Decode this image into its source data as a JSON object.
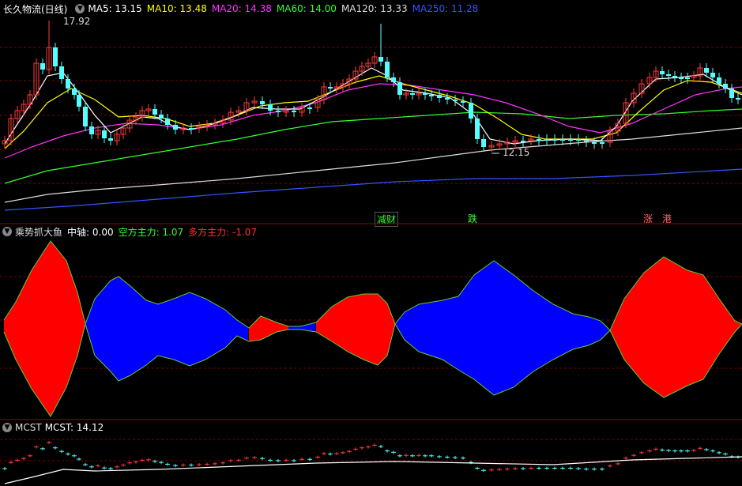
{
  "colors": {
    "up": "#ff3b3b",
    "down": "#54ffff",
    "ma5": "#ffffff",
    "ma10": "#ffff00",
    "ma20": "#ff33ff",
    "ma60": "#33ff33",
    "ma120": "#dddddd",
    "ma250": "#3355ff",
    "grid": "#7a0000",
    "bull": "#ff0000",
    "bear": "#0000ff",
    "axis": "#9a0000"
  },
  "main": {
    "title": "长久物流(日线)",
    "indicators": [
      {
        "label": "MA5: 13.15",
        "color": "#ffffff"
      },
      {
        "label": "MA10: 13.48",
        "color": "#ffff00"
      },
      {
        "label": "MA20: 14.38",
        "color": "#ff33ff"
      },
      {
        "label": "MA60: 14.00",
        "color": "#33ff33"
      },
      {
        "label": "MA120: 13.33",
        "color": "#dddddd"
      },
      {
        "label": "MA250: 11.28",
        "color": "#3355ff"
      }
    ],
    "high_label": "17.92",
    "low_label": "12.15",
    "event_tags": [
      {
        "text": "减财",
        "color": "#33ff33"
      },
      {
        "text": "跌",
        "color": "#33ff33"
      },
      {
        "text": "涨",
        "color": "#ff6666"
      },
      {
        "text": "港",
        "color": "#ff6666"
      }
    ]
  },
  "osc": {
    "title": "乘势抓大鱼",
    "mid": "中轴: 0.00",
    "short": "空方主力: 1.07",
    "long": "多方主力: -1.07"
  },
  "mcst": {
    "title": "MCST",
    "value": "MCST: 14.12"
  }
}
